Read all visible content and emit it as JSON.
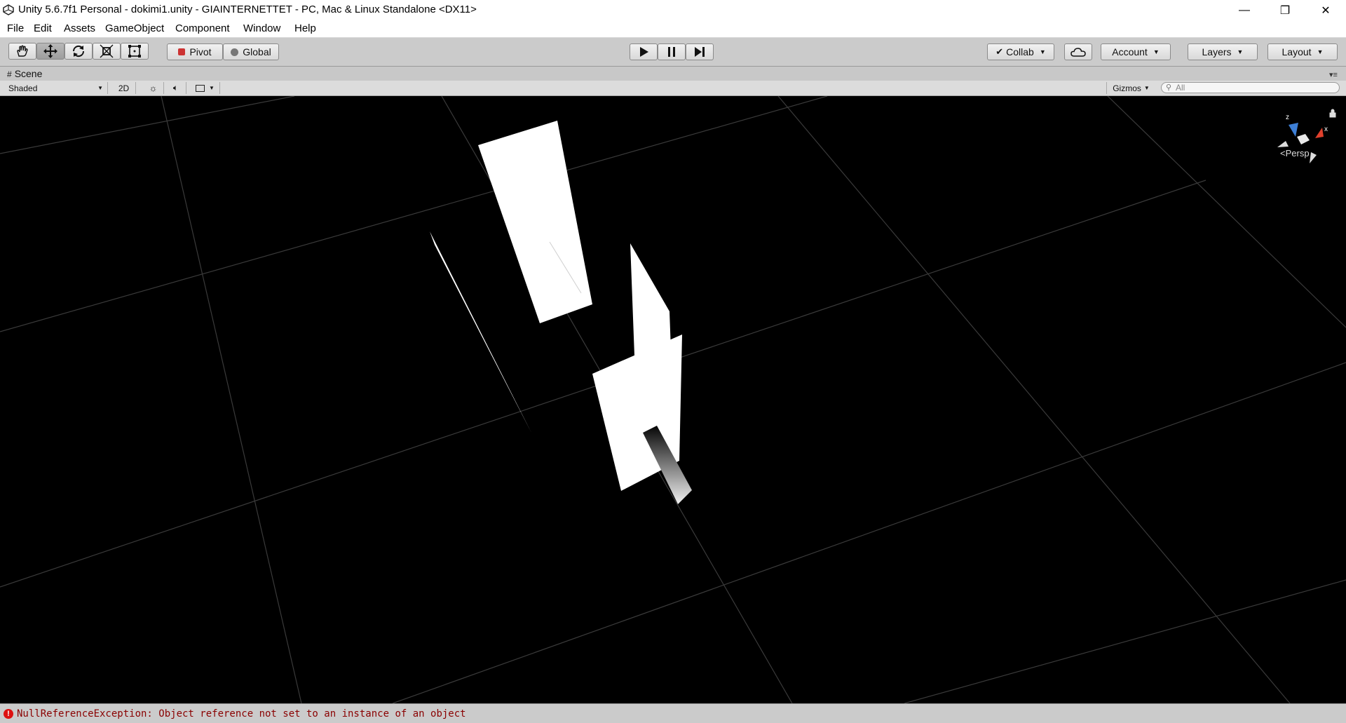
{
  "window": {
    "title": "Unity 5.6.7f1 Personal - dokimi1.unity - GIAINTERNETTET - PC, Mac & Linux Standalone <DX11>",
    "controls": {
      "minimize": "—",
      "restore": "❐",
      "close": "✕"
    }
  },
  "menu": [
    "File",
    "Edit",
    "Assets",
    "GameObject",
    "Component",
    "Window",
    "Help"
  ],
  "toolbar": {
    "transform_tools": [
      "hand-icon",
      "move-icon",
      "rotate-icon",
      "scale-icon",
      "rect-icon"
    ],
    "active_tool": "move-icon",
    "pivot_label": "Pivot",
    "global_label": "Global",
    "collab_label": "Collab",
    "account_label": "Account",
    "layers_label": "Layers",
    "layout_label": "Layout"
  },
  "scene": {
    "tab_label": "Scene",
    "shading_mode": "Shaded",
    "mode_2d": "2D",
    "gizmos_label": "Gizmos",
    "search_placeholder": "All",
    "view_label": "Persp",
    "axis_labels": {
      "x": "x",
      "z": "z"
    }
  },
  "status": {
    "message": "NullReferenceException: Object reference not set to an instance of an object",
    "level": "error"
  },
  "colors": {
    "toolbar_bg": "#cbcbcb",
    "viewport_bg": "#000000",
    "grid_line": "#3a3a3a",
    "error_text": "#8a0000",
    "axis_x": "#e0402c",
    "axis_z": "#3d7fd6"
  }
}
